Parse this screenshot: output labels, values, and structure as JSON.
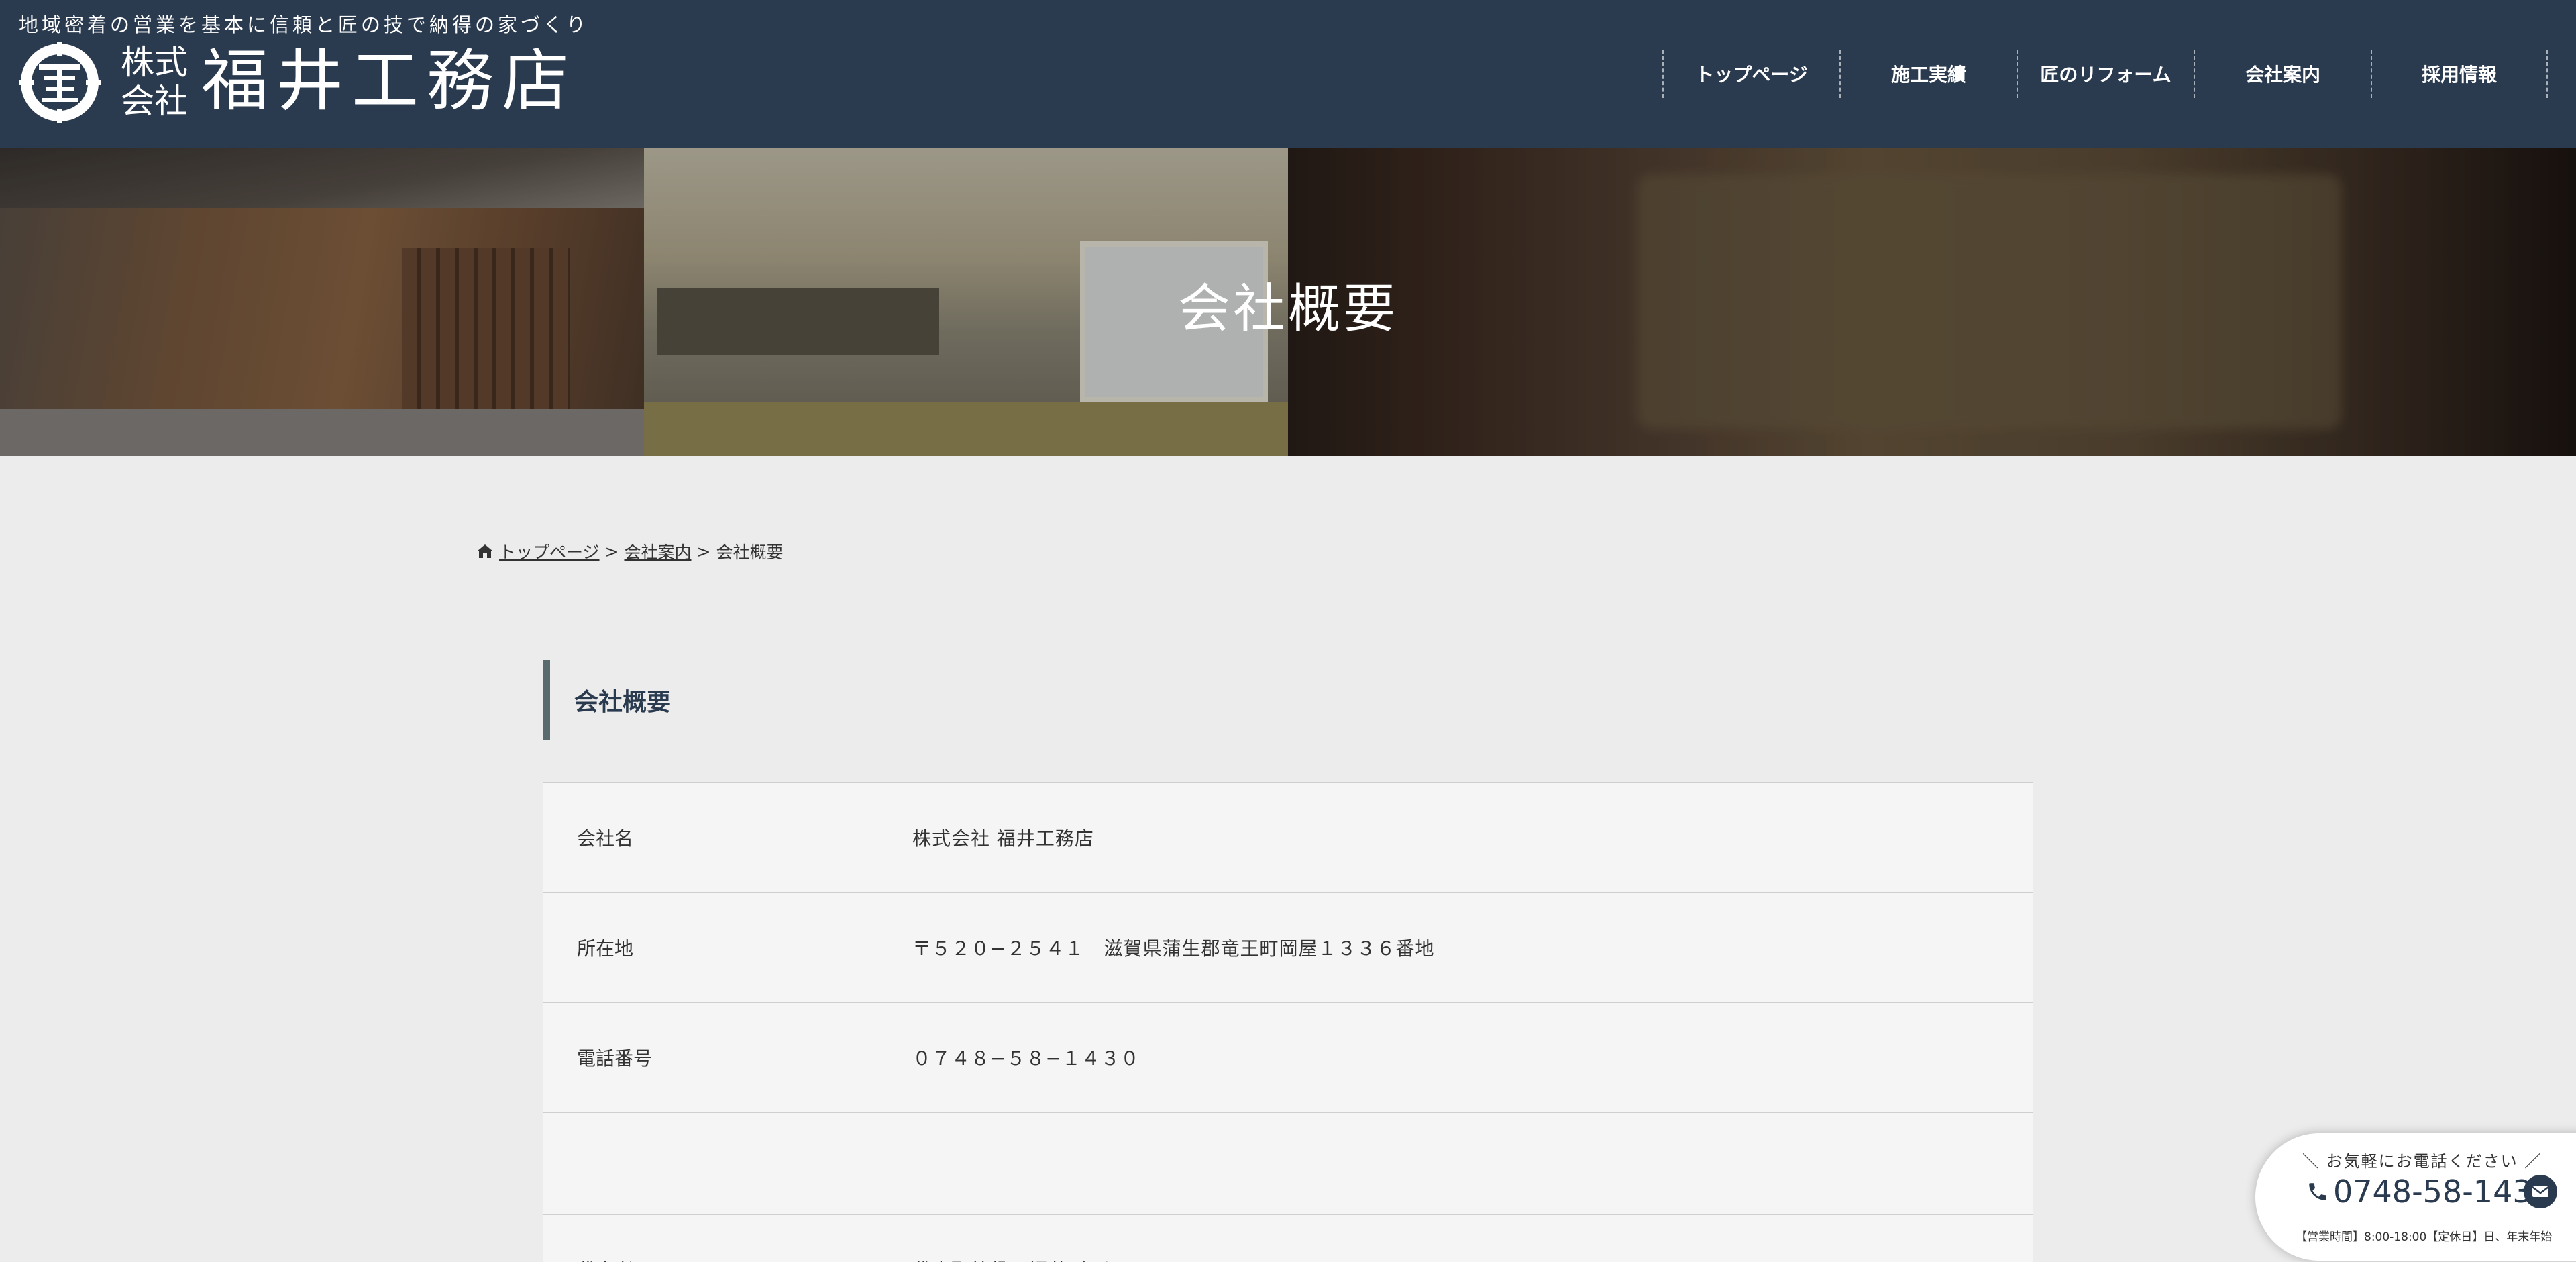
{
  "header": {
    "tagline": "地域密着の営業を基本に信頼と匠の技で納得の家づくり",
    "logo_kabushiki_top": "株式",
    "logo_kabushiki_bottom": "会社",
    "logo_name": "福井工務店",
    "nav": [
      {
        "label": "トップページ"
      },
      {
        "label": "施工実績"
      },
      {
        "label": "匠のリフォーム"
      },
      {
        "label": "会社案内"
      },
      {
        "label": "採用情報"
      }
    ]
  },
  "hero": {
    "title": "会社概要"
  },
  "breadcrumb": {
    "home": "トップページ",
    "sep": ">",
    "parent": "会社案内",
    "current": "会社概要"
  },
  "section": {
    "heading": "会社概要"
  },
  "company_table": [
    {
      "label": "会社名",
      "value": "株式会社 福井工務店"
    },
    {
      "label": "所在地",
      "value": "〒５２０−２５４１　滋賀県蒲生郡竜王町岡屋１３３６番地"
    },
    {
      "label": "電話番号",
      "value": "０７４８−５８−１４３０"
    },
    {
      "label": "",
      "value": ""
    },
    {
      "label": "代表者",
      "value": "代表取締役　福井 惠弘"
    }
  ],
  "contact": {
    "lead": "お気軽にお電話ください",
    "phone": "0748-58-1430",
    "hours": "【営業時間】8:00-18:00【定休日】日、年末年始"
  },
  "colors": {
    "header_bg": "#2a3a4f",
    "page_bg": "#ececec",
    "table_row_bg": "#f5f5f5",
    "accent_bar": "#5a6b6e"
  },
  "icons": [
    "logo-mark-icon",
    "home-icon",
    "phone-icon",
    "mail-icon"
  ]
}
